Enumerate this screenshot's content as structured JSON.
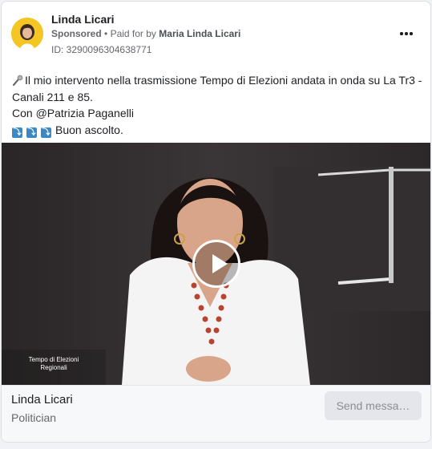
{
  "post": {
    "author": "Linda Licari",
    "sponsored_label": "Sponsored",
    "separator": "•",
    "paid_for_prefix": "Paid for by",
    "payer": "Maria Linda Licari",
    "ad_id": "ID: 3290096304638771",
    "more_icon": "more-horizontal-icon"
  },
  "body": {
    "line1": "Il mio intervento nella trasmissione Tempo di Elezioni andata in onda su La Tr3 - Canali 211 e 85.",
    "line2": "Con @Patrizia Paganelli",
    "line3": "Buon ascolto.",
    "mic_icon": "microphone-icon",
    "arrow_icon": "down-arrow-icon",
    "arrow_glyph": "⤵"
  },
  "video": {
    "caption_line1": "Tempo di Elezioni",
    "caption_line2": "Regionali",
    "play_icon": "play-icon"
  },
  "footer": {
    "page_name": "Linda Licari",
    "category": "Politician",
    "cta_label": "Send messa…"
  },
  "colors": {
    "avatar_bg": "#f3c623",
    "cta_bg": "#e4e6eb",
    "arrow_bg": "#3b88c3"
  }
}
